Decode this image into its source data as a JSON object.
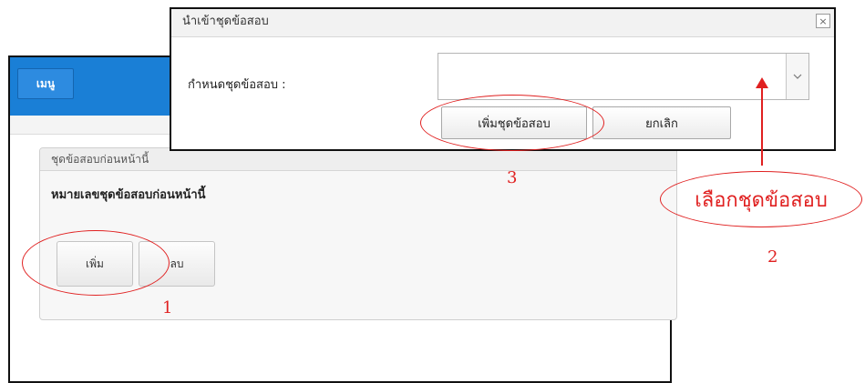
{
  "background_window": {
    "menu_label": "เมนู",
    "panel": {
      "title": "ชุดข้อสอบก่อนหน้านี้",
      "label": "หมายเลขชุดข้อสอบก่อนหน้านี้",
      "add_label": "เพิ่ม",
      "delete_label": "ลบ"
    }
  },
  "dialog": {
    "title": "นำเข้าชุดข้อสอบ",
    "close_glyph": "×",
    "field_label": "กำหนดชุดข้อสอบ :",
    "select_value": "",
    "select_arrow": "chevron-down-icon",
    "add_label": "เพิ่มชุดข้อสอบ",
    "cancel_label": "ยกเลิก"
  },
  "annotations": {
    "step1": "1",
    "step2": "2",
    "step3": "3",
    "callout": "เลือกชุดข้อสอบ",
    "color": "#e02020"
  },
  "colors": {
    "header_blue": "#1a7fd6",
    "panel_bg": "#f7f7f7"
  }
}
